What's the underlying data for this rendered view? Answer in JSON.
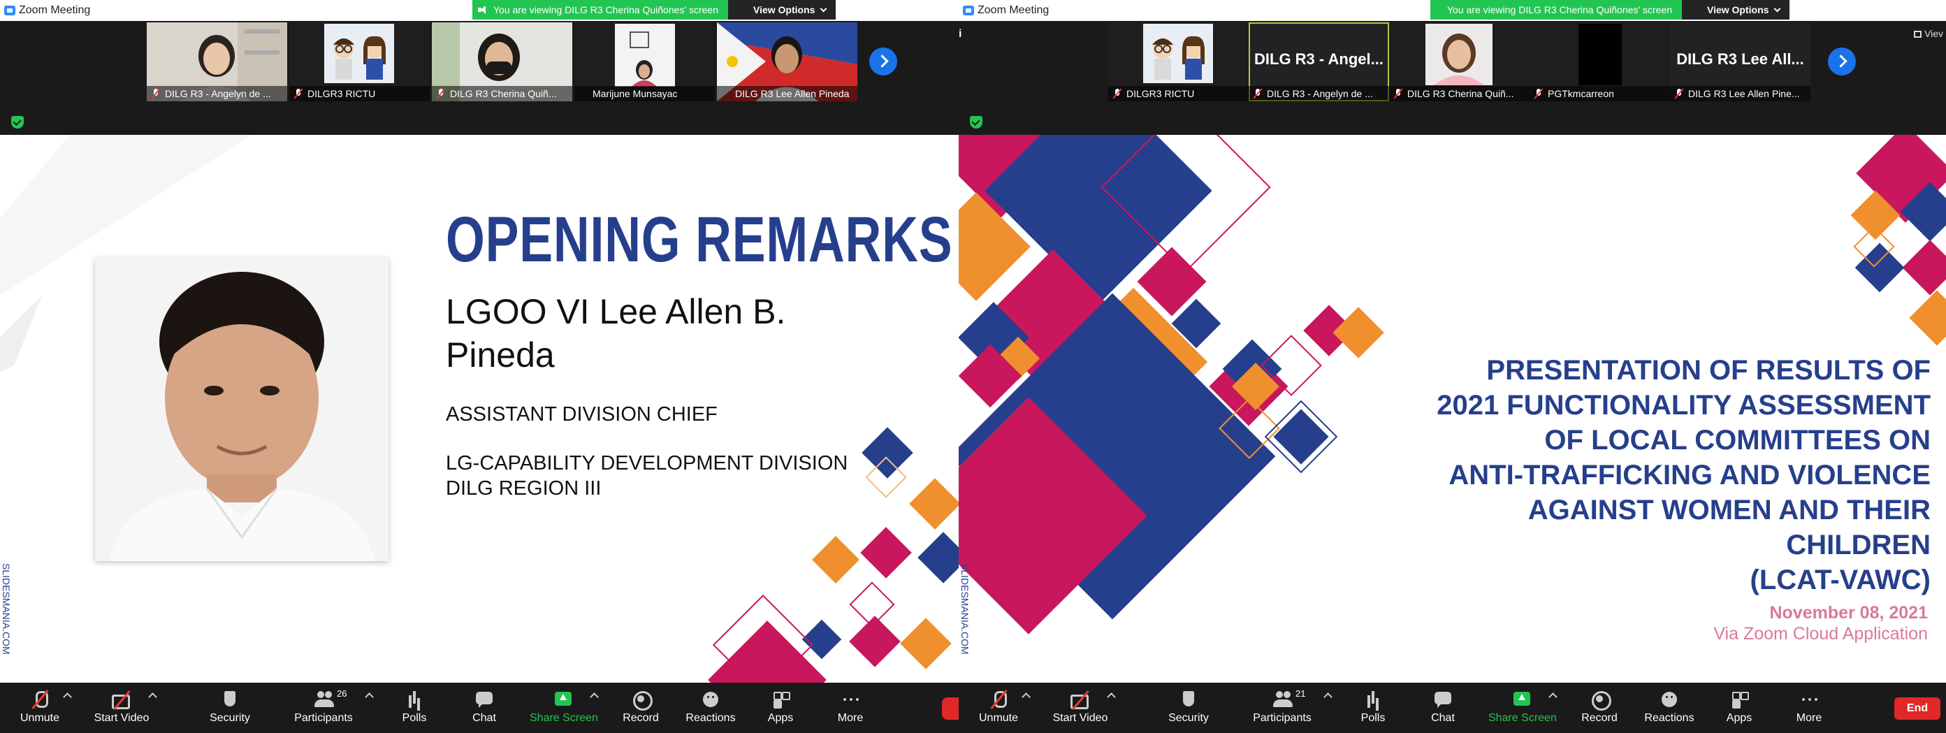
{
  "left": {
    "app_title": "Zoom Meeting",
    "viewing_banner": "You are viewing DILG R3 Cherina Quiñones' screen",
    "view_options": "View Options",
    "participants": [
      {
        "name": "DILG R3 - Angelyn de ...",
        "type": "video-woman"
      },
      {
        "name": "DILGR3 RICTU",
        "type": "avatar-cartoon"
      },
      {
        "name": "DILG R3 Cherina Quiñ...",
        "type": "video-woman-mask"
      },
      {
        "name": "Marijune Munsayac",
        "type": "video-woman-glasses"
      },
      {
        "name": "DILG R3 Lee Allen Pineda",
        "type": "video-man"
      }
    ],
    "slide": {
      "title": "OPENING REMARKS",
      "speaker_line1": "LGOO VI Lee Allen B.",
      "speaker_line2": "Pineda",
      "position": "ASSISTANT DIVISION CHIEF",
      "division": "LG-CAPABILITY DEVELOPMENT DIVISION",
      "office": "DILG REGION III",
      "credit": "SLIDESMANIA.COM"
    },
    "toolbar": {
      "unmute": "Unmute",
      "start_video": "Start Video",
      "security": "Security",
      "participants": "Participants",
      "participants_count": "26",
      "polls": "Polls",
      "chat": "Chat",
      "share_screen": "Share Screen",
      "record": "Record",
      "reactions": "Reactions",
      "apps": "Apps",
      "more": "More"
    }
  },
  "right": {
    "app_title": "Zoom Meeting",
    "viewing_banner": "You are viewing DILG R3 Cherina Quiñones' screen",
    "view_options": "View Options",
    "info_icon": "i",
    "view_label": "Viev",
    "participants": [
      {
        "name": "DILGR3 RICTU",
        "type": "avatar-cartoon",
        "text": ""
      },
      {
        "name": "DILG R3 - Angelyn de ...",
        "type": "text",
        "text": "DILG R3 - Angel..."
      },
      {
        "name": "DILG R3 Cherina Quiñ...",
        "type": "video-woman",
        "text": ""
      },
      {
        "name": "PGTkmcarreon",
        "type": "black",
        "text": ""
      },
      {
        "name": "DILG R3 Lee Allen Pine...",
        "type": "text",
        "text": "DILG R3 Lee All..."
      }
    ],
    "slide": {
      "title_lines": [
        "PRESENTATION OF RESULTS OF",
        "2021 FUNCTIONALITY ASSESSMENT",
        "OF LOCAL COMMITTEES ON",
        "ANTI-TRAFFICKING AND VIOLENCE",
        "AGAINST WOMEN AND THEIR",
        "CHILDREN",
        "(LCAT-VAWC)"
      ],
      "date": "November 08, 2021",
      "via": "Via Zoom Cloud Application",
      "credit": "SLIDESMANIA.COM"
    },
    "toolbar": {
      "unmute": "Unmute",
      "start_video": "Start Video",
      "security": "Security",
      "participants": "Participants",
      "participants_count": "21",
      "polls": "Polls",
      "chat": "Chat",
      "share_screen": "Share Screen",
      "record": "Record",
      "reactions": "Reactions",
      "apps": "Apps",
      "more": "More",
      "end": "End"
    }
  },
  "colors": {
    "zoom_blue": "#2d8cff",
    "banner_green": "#23c552",
    "slide_navy": "#263f8c",
    "slide_magenta": "#c8175d",
    "slide_orange": "#ef8f2e",
    "date_pink": "#d9799b",
    "end_red": "#e02828"
  }
}
